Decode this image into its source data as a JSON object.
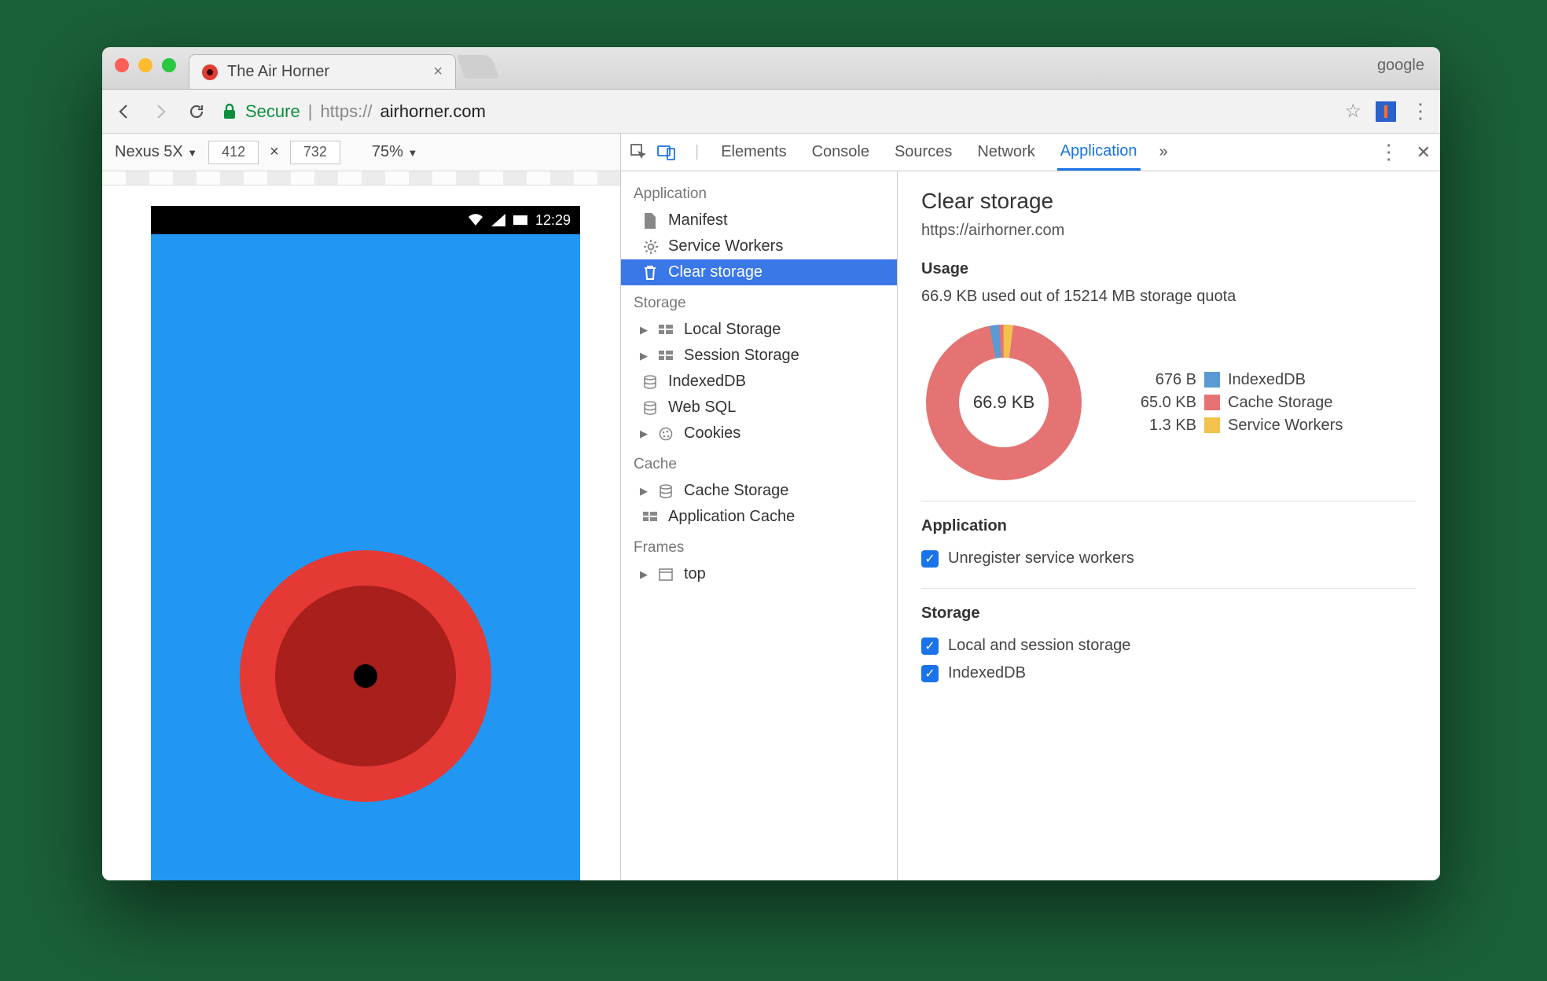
{
  "window": {
    "tab_title": "The Air Horner",
    "profile": "google"
  },
  "address_bar": {
    "secure_label": "Secure",
    "protocol": "https://",
    "host": "airhorner.com"
  },
  "device_toolbar": {
    "device": "Nexus 5X",
    "width": "412",
    "height": "732",
    "zoom": "75%"
  },
  "phone_status": {
    "time": "12:29"
  },
  "devtools_tabs": {
    "elements": "Elements",
    "console": "Console",
    "sources": "Sources",
    "network": "Network",
    "application": "Application"
  },
  "sidebar": {
    "application": {
      "header": "Application",
      "manifest": "Manifest",
      "service_workers": "Service Workers",
      "clear_storage": "Clear storage"
    },
    "storage": {
      "header": "Storage",
      "local_storage": "Local Storage",
      "session_storage": "Session Storage",
      "indexeddb": "IndexedDB",
      "web_sql": "Web SQL",
      "cookies": "Cookies"
    },
    "cache": {
      "header": "Cache",
      "cache_storage": "Cache Storage",
      "app_cache": "Application Cache"
    },
    "frames": {
      "header": "Frames",
      "top": "top"
    }
  },
  "detail": {
    "title": "Clear storage",
    "origin": "https://airhorner.com",
    "usage": {
      "header": "Usage",
      "summary": "66.9 KB used out of 15214 MB storage quota",
      "total": "66.9 KB",
      "legend": {
        "indexeddb_size": "676 B",
        "indexeddb_label": "IndexedDB",
        "cache_size": "65.0 KB",
        "cache_label": "Cache Storage",
        "sw_size": "1.3 KB",
        "sw_label": "Service Workers"
      }
    },
    "application": {
      "header": "Application",
      "unregister": "Unregister service workers"
    },
    "storage_section": {
      "header": "Storage",
      "local_session": "Local and session storage",
      "indexeddb": "IndexedDB"
    }
  },
  "chart_data": {
    "type": "pie",
    "title": "Storage usage",
    "series": [
      {
        "name": "IndexedDB",
        "value": 676,
        "unit": "B",
        "color": "#5b9bd5"
      },
      {
        "name": "Cache Storage",
        "value": 66560,
        "unit": "B",
        "display": "65.0 KB",
        "color": "#e57373"
      },
      {
        "name": "Service Workers",
        "value": 1331,
        "unit": "B",
        "display": "1.3 KB",
        "color": "#f2c14e"
      }
    ],
    "total_display": "66.9 KB"
  }
}
